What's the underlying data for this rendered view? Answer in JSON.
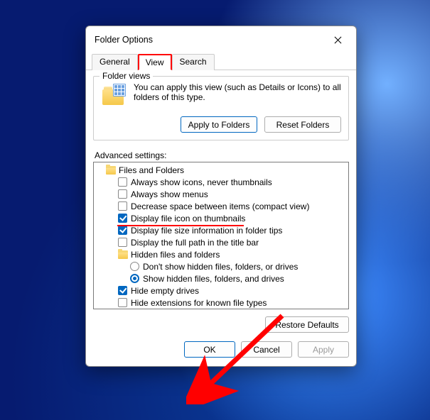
{
  "dialog": {
    "title": "Folder Options",
    "tabs": [
      "General",
      "View",
      "Search"
    ],
    "active_tab": "View"
  },
  "folder_views": {
    "title": "Folder views",
    "text": "You can apply this view (such as Details or Icons) to all folders of this type.",
    "apply_btn": "Apply to Folders",
    "reset_btn": "Reset Folders"
  },
  "advanced": {
    "label": "Advanced settings:",
    "root": "Files and Folders",
    "items": [
      {
        "label": "Always show icons, never thumbnails",
        "checked": false
      },
      {
        "label": "Always show menus",
        "checked": false
      },
      {
        "label": "Decrease space between items (compact view)",
        "checked": false
      },
      {
        "label": "Display file icon on thumbnails",
        "checked": true
      },
      {
        "label": "Display file size information in folder tips",
        "checked": true
      },
      {
        "label": "Display the full path in the title bar",
        "checked": false
      }
    ],
    "hidden": {
      "label": "Hidden files and folders",
      "options": [
        {
          "label": "Don't show hidden files, folders, or drives",
          "selected": false
        },
        {
          "label": "Show hidden files, folders, and drives",
          "selected": true
        }
      ]
    },
    "items_after": [
      {
        "label": "Hide empty drives",
        "checked": true
      },
      {
        "label": "Hide extensions for known file types",
        "checked": false
      }
    ],
    "restore_btn": "Restore Defaults"
  },
  "buttons": {
    "ok": "OK",
    "cancel": "Cancel",
    "apply": "Apply"
  },
  "annotations": {
    "tab_highlight_color": "#ff0000",
    "underline_color": "#ff0000",
    "arrow_color": "#ff0000"
  }
}
